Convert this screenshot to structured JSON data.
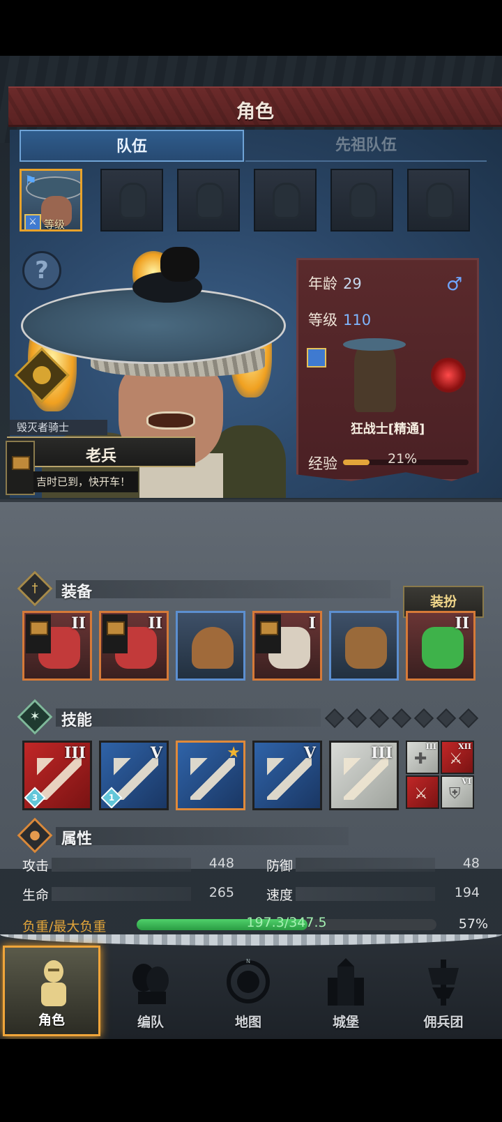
{
  "screen_title": "角色",
  "tabs": {
    "team": "队伍",
    "ancestor": "先祖队伍"
  },
  "team_slots": {
    "active_level": "等级110"
  },
  "hero": {
    "class_tag": "毁灭者骑士",
    "name": "老兵",
    "motto": "吉时已到，快开车！"
  },
  "info": {
    "age_label": "年龄",
    "age": "29",
    "level_label": "等级",
    "level": "110",
    "class_name": "狂战士[精通]",
    "exp_label": "经验",
    "exp_pct": "21%",
    "exp_fraction": 0.21,
    "gender_icon": "male-icon"
  },
  "equipment": {
    "title": "装备",
    "dress_button": "装扮",
    "items": [
      {
        "tier": "II",
        "has_chest": true,
        "rarity": "orange"
      },
      {
        "tier": "II",
        "has_chest": true,
        "rarity": "orange"
      },
      {
        "tier": "",
        "has_chest": false,
        "rarity": "blue"
      },
      {
        "tier": "I",
        "has_chest": true,
        "rarity": "orange"
      },
      {
        "tier": "",
        "has_chest": false,
        "rarity": "blue"
      },
      {
        "tier": "II",
        "has_chest": false,
        "rarity": "orange"
      }
    ]
  },
  "skills": {
    "title": "技能",
    "slots_count": 7,
    "items": [
      {
        "tier": "III",
        "badge": "3",
        "color": "red"
      },
      {
        "tier": "V",
        "badge": "1",
        "color": "blue"
      },
      {
        "tier": "",
        "badge": "",
        "color": "blue",
        "starred": true
      },
      {
        "tier": "V",
        "badge": "",
        "color": "blue"
      },
      {
        "tier": "III",
        "badge": "",
        "color": "gray"
      }
    ],
    "passives": [
      {
        "tier": "III",
        "color": "gray"
      },
      {
        "tier": "XII",
        "color": "red"
      },
      {
        "tier": "",
        "color": "red"
      },
      {
        "tier": "VI",
        "color": "gray"
      }
    ]
  },
  "attributes": {
    "title": "属性",
    "attack_label": "攻击",
    "attack": "448",
    "defense_label": "防御",
    "defense": "48",
    "hp_label": "生命",
    "hp": "265",
    "speed_label": "速度",
    "speed": "194",
    "weight_label": "负重/最大负重",
    "weight": "197.3/347.5",
    "weight_pct": "57%",
    "weight_fraction": 0.57
  },
  "nav": {
    "character": "角色",
    "formation": "编队",
    "map": "地图",
    "castle": "城堡",
    "mercenary": "佣兵团"
  },
  "colors": {
    "accent_orange": "#e8a22a",
    "title_red": "#6b2a2a",
    "panel_blue": "#2b4768",
    "weight_green": "#4fd06a"
  }
}
